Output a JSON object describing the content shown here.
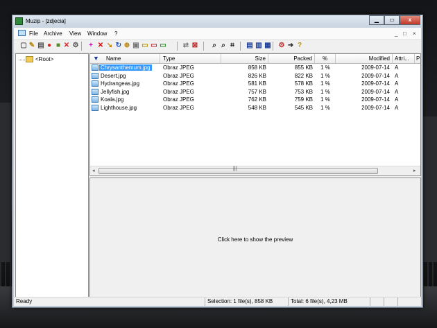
{
  "window": {
    "title": "Muzip - [zdjecia]",
    "close_glyph": "x"
  },
  "menu": [
    "File",
    "Archive",
    "View",
    "Window",
    "?"
  ],
  "mdi_controls": [
    "_",
    "□",
    "×"
  ],
  "toolbar": [
    {
      "name": "new-archive-icon",
      "glyph": "▢",
      "color": "#555"
    },
    {
      "name": "open-archive-icon",
      "glyph": "✎",
      "color": "#b8860b"
    },
    {
      "name": "save-archive-icon",
      "glyph": "▤",
      "color": "#555"
    },
    {
      "name": "extract-icon",
      "glyph": "●",
      "color": "#d22"
    },
    {
      "name": "folder-open-icon",
      "glyph": "■",
      "color": "#5a8a2a"
    },
    {
      "name": "delete-archive-icon",
      "glyph": "✕",
      "color": "#d22"
    },
    {
      "name": "properties-icon",
      "glyph": "⚙",
      "color": "#555"
    },
    {
      "name": "add-files-icon",
      "glyph": "+",
      "color": "#d600c8"
    },
    {
      "name": "delete-files-icon",
      "glyph": "✕",
      "color": "#d00"
    },
    {
      "name": "extract-files-icon",
      "glyph": "↘",
      "color": "#c08000"
    },
    {
      "name": "refresh-icon",
      "glyph": "↻",
      "color": "#1a4db3"
    },
    {
      "name": "new-folder-icon",
      "glyph": "⊕",
      "color": "#b8860b"
    },
    {
      "name": "view-files-icon",
      "glyph": "▣",
      "color": "#777"
    },
    {
      "name": "select-icon",
      "glyph": "▭",
      "color": "#b89400"
    },
    {
      "name": "deselect-icon",
      "glyph": "▭",
      "color": "#c03030"
    },
    {
      "name": "invert-selection-icon",
      "glyph": "▭",
      "color": "#2a8a2a"
    },
    {
      "name": "test-archive-icon",
      "glyph": "⇄",
      "color": "#777"
    },
    {
      "name": "cancel-icon",
      "glyph": "⊠",
      "color": "#c02020"
    },
    {
      "name": "find-icon",
      "glyph": "⌕",
      "color": "#222"
    },
    {
      "name": "find-next-icon",
      "glyph": "⌕",
      "color": "#222"
    },
    {
      "name": "filter-icon",
      "glyph": "⌗",
      "color": "#222"
    },
    {
      "name": "cascade-windows-icon",
      "glyph": "▤",
      "color": "#1a3d9a"
    },
    {
      "name": "tile-horizontal-icon",
      "glyph": "▥",
      "color": "#1a3d9a"
    },
    {
      "name": "tile-vertical-icon",
      "glyph": "▦",
      "color": "#1a3d9a"
    },
    {
      "name": "options-icon",
      "glyph": "⚙",
      "color": "#c03030"
    },
    {
      "name": "exit-icon",
      "glyph": "➜",
      "color": "#333"
    },
    {
      "name": "help-icon",
      "glyph": "?",
      "color": "#b89400"
    }
  ],
  "tree": {
    "root_label": "<Root>"
  },
  "columns": [
    "Name",
    "Type",
    "Size",
    "Packed",
    "%",
    "Modified",
    "Attri...",
    "P"
  ],
  "files": [
    {
      "name": "Chrysanthemum.jpg",
      "type": "Obraz JPEG",
      "size": "858 KB",
      "packed": "855 KB",
      "pct": "1 %",
      "modified": "2009-07-14",
      "attr": "A",
      "selected": true
    },
    {
      "name": "Desert.jpg",
      "type": "Obraz JPEG",
      "size": "826 KB",
      "packed": "822 KB",
      "pct": "1 %",
      "modified": "2009-07-14",
      "attr": "A",
      "selected": false
    },
    {
      "name": "Hydrangeas.jpg",
      "type": "Obraz JPEG",
      "size": "581 KB",
      "packed": "578 KB",
      "pct": "1 %",
      "modified": "2009-07-14",
      "attr": "A",
      "selected": false
    },
    {
      "name": "Jellyfish.jpg",
      "type": "Obraz JPEG",
      "size": "757 KB",
      "packed": "753 KB",
      "pct": "1 %",
      "modified": "2009-07-14",
      "attr": "A",
      "selected": false
    },
    {
      "name": "Koala.jpg",
      "type": "Obraz JPEG",
      "size": "762 KB",
      "packed": "759 KB",
      "pct": "1 %",
      "modified": "2009-07-14",
      "attr": "A",
      "selected": false
    },
    {
      "name": "Lighthouse.jpg",
      "type": "Obraz JPEG",
      "size": "548 KB",
      "packed": "545 KB",
      "pct": "1 %",
      "modified": "2009-07-14",
      "attr": "A",
      "selected": false
    }
  ],
  "scrollbar": {
    "left_arrow": "◂",
    "right_arrow": "▸",
    "grip": "|||"
  },
  "preview": {
    "text": "Click here to show the preview"
  },
  "status": {
    "left": "Ready",
    "selection": "Selection: 1 file(s), 858 KB",
    "total": "Total: 6 file(s), 4,23 MB"
  },
  "colors": {
    "selection": "#3399ff",
    "accent": "#1a3d9a"
  }
}
